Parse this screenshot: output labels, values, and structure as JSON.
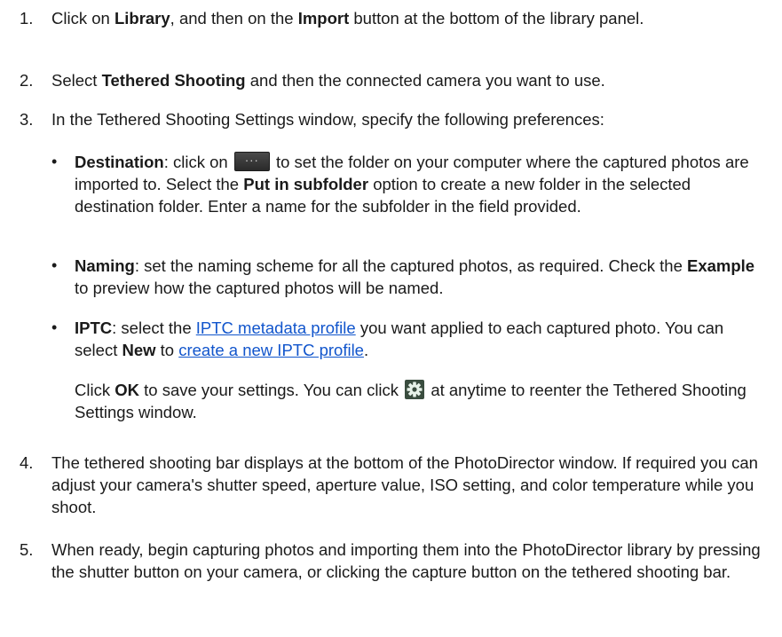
{
  "steps": [
    {
      "num": "1.",
      "parts": [
        "Click on ",
        "Library",
        ", and then on the ",
        "Import",
        " button at the bottom of the library panel."
      ]
    },
    {
      "num": "2.",
      "parts": [
        "Select ",
        "Tethered Shooting",
        " and then the connected camera you want to use."
      ]
    },
    {
      "num": "3.",
      "parts": [
        "In the Tethered Shooting Settings window, specify the following preferences:"
      ]
    },
    {
      "num": "4.",
      "parts": [
        "The tethered shooting bar displays at the bottom of the PhotoDirector window. If required you can adjust your camera's shutter speed, aperture value, ISO setting, and color temperature while you shoot."
      ]
    },
    {
      "num": "5.",
      "parts": [
        "When ready, begin capturing photos and importing them into the PhotoDirector library by pressing the shutter button on your camera, or clicking the capture button on the tethered shooting bar."
      ]
    }
  ],
  "bullets": {
    "destination": {
      "dot": "•",
      "label": "Destination",
      "t1": ": click on ",
      "button_dots": "···",
      "t2": " to set the folder on your computer where the captured photos are imported to. Select the ",
      "opt": "Put in subfolder",
      "t3": " option to create a new folder in the selected destination folder. Enter a name for the subfolder in the field provided."
    },
    "naming": {
      "dot": "•",
      "label": "Naming",
      "t1": ": set the naming scheme for all the captured photos, as required. Check the ",
      "example": "Example",
      "t2": " to preview how the captured photos will be named."
    },
    "iptc": {
      "dot": "•",
      "label": "IPTC",
      "t1": ": select the ",
      "link1": "IPTC metadata profile",
      "t2": " you want applied to each captured photo. You can select ",
      "new_label": "New",
      "t3": " to ",
      "link2": "create a new IPTC profile",
      "t4": "."
    }
  },
  "ok_para": {
    "t1": "Click ",
    "ok": "OK",
    "t2": " to save your settings. You can click ",
    "t3": " at anytime to reenter the Tethered Shooting Settings window."
  },
  "colors": {
    "link": "#1155cc",
    "text": "#1a1a1a",
    "gear_bg": "#3a4d3f",
    "gear_fg": "#e7f2e9"
  }
}
